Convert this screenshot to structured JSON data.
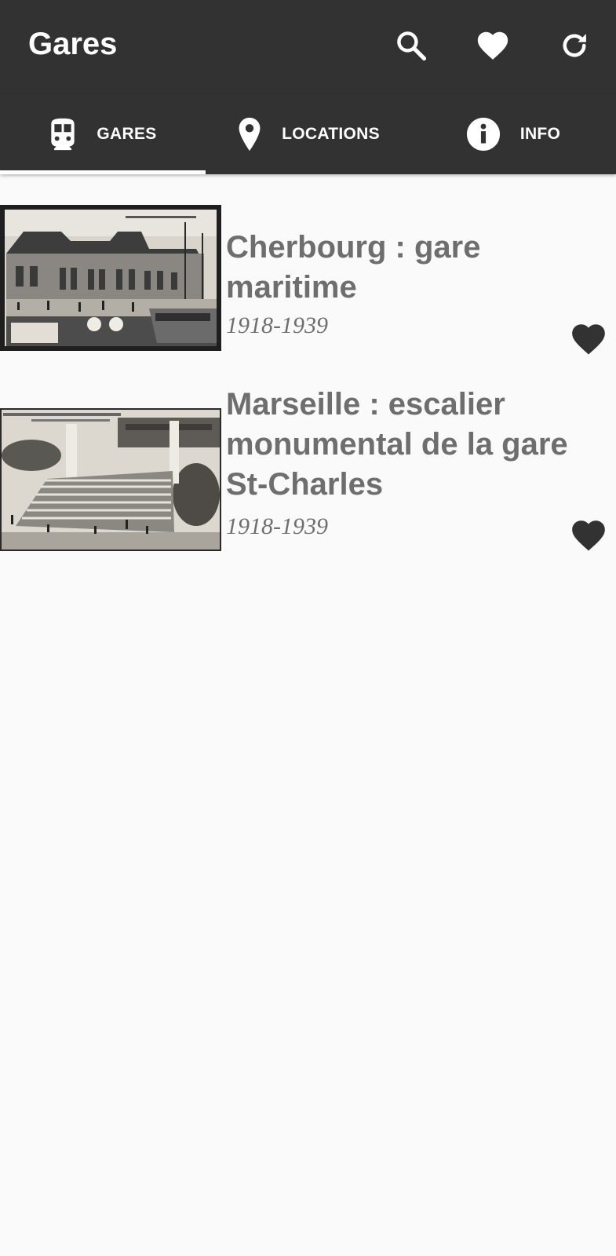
{
  "app": {
    "title": "Gares",
    "actions": [
      {
        "icon": "search-icon"
      },
      {
        "icon": "heart-icon"
      },
      {
        "icon": "refresh-icon"
      }
    ]
  },
  "tabs": [
    {
      "label": "GARES",
      "icon": "train-icon",
      "selected": true
    },
    {
      "label": "LOCATIONS",
      "icon": "map-pin-icon",
      "selected": false
    },
    {
      "label": "INFO",
      "icon": "info-icon",
      "selected": false
    }
  ],
  "items": [
    {
      "title": "Cherbourg : gare maritime",
      "years": "1918-1939",
      "favorite": true,
      "icon": "heart-icon"
    },
    {
      "title": "Marseille : escalier monumental de la gare St-Charles",
      "years": "1918-1939",
      "favorite": true,
      "icon": "heart-icon"
    }
  ],
  "colors": {
    "bar": "#323232",
    "background": "#fafafa",
    "text_secondary": "#6e6e6e",
    "heart": "#323232",
    "indicator": "#ffffff"
  }
}
